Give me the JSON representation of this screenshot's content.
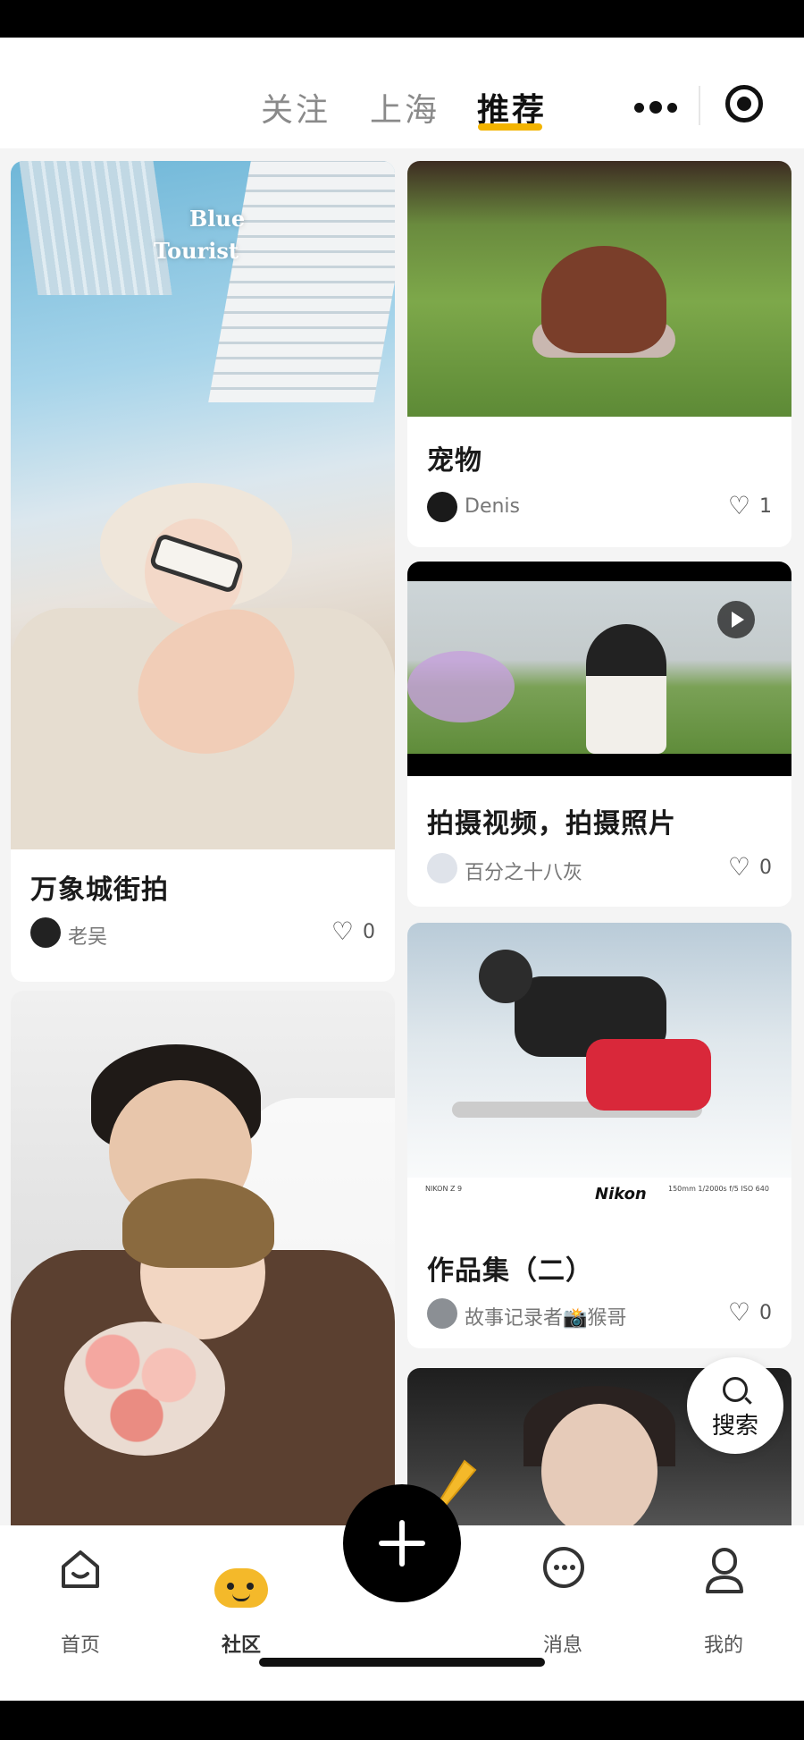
{
  "header": {
    "tabs": [
      {
        "label": "关注",
        "active": false
      },
      {
        "label": "上海",
        "active": false
      },
      {
        "label": "推荐",
        "active": true
      }
    ],
    "accent_color": "#f3b400"
  },
  "feed": {
    "left": [
      {
        "title": "万象城街拍",
        "author": "老吴",
        "likes": "0",
        "overlay": {
          "line1": "Blue",
          "line2": "Tourist"
        }
      }
    ],
    "right": [
      {
        "title": "宠物",
        "author": "Denis",
        "likes": "1"
      },
      {
        "title": "拍摄视频，拍摄照片",
        "author": "百分之十八灰",
        "likes": "0",
        "is_video": true
      },
      {
        "title": "作品集（二）",
        "author": "故事记录者📸猴哥",
        "likes": "0",
        "photo_caption": {
          "left": "NIKON Z 9",
          "brand": "Nikon",
          "right": "150mm 1/2000s f/5 ISO 640"
        }
      }
    ]
  },
  "search_fab": {
    "label": "搜索"
  },
  "bottom_nav": {
    "items": [
      {
        "label": "首页",
        "icon": "home-icon"
      },
      {
        "label": "社区",
        "icon": "community-icon",
        "active": true
      },
      {
        "label": "",
        "icon": "plus-icon"
      },
      {
        "label": "消息",
        "icon": "message-icon"
      },
      {
        "label": "我的",
        "icon": "profile-icon"
      }
    ]
  }
}
